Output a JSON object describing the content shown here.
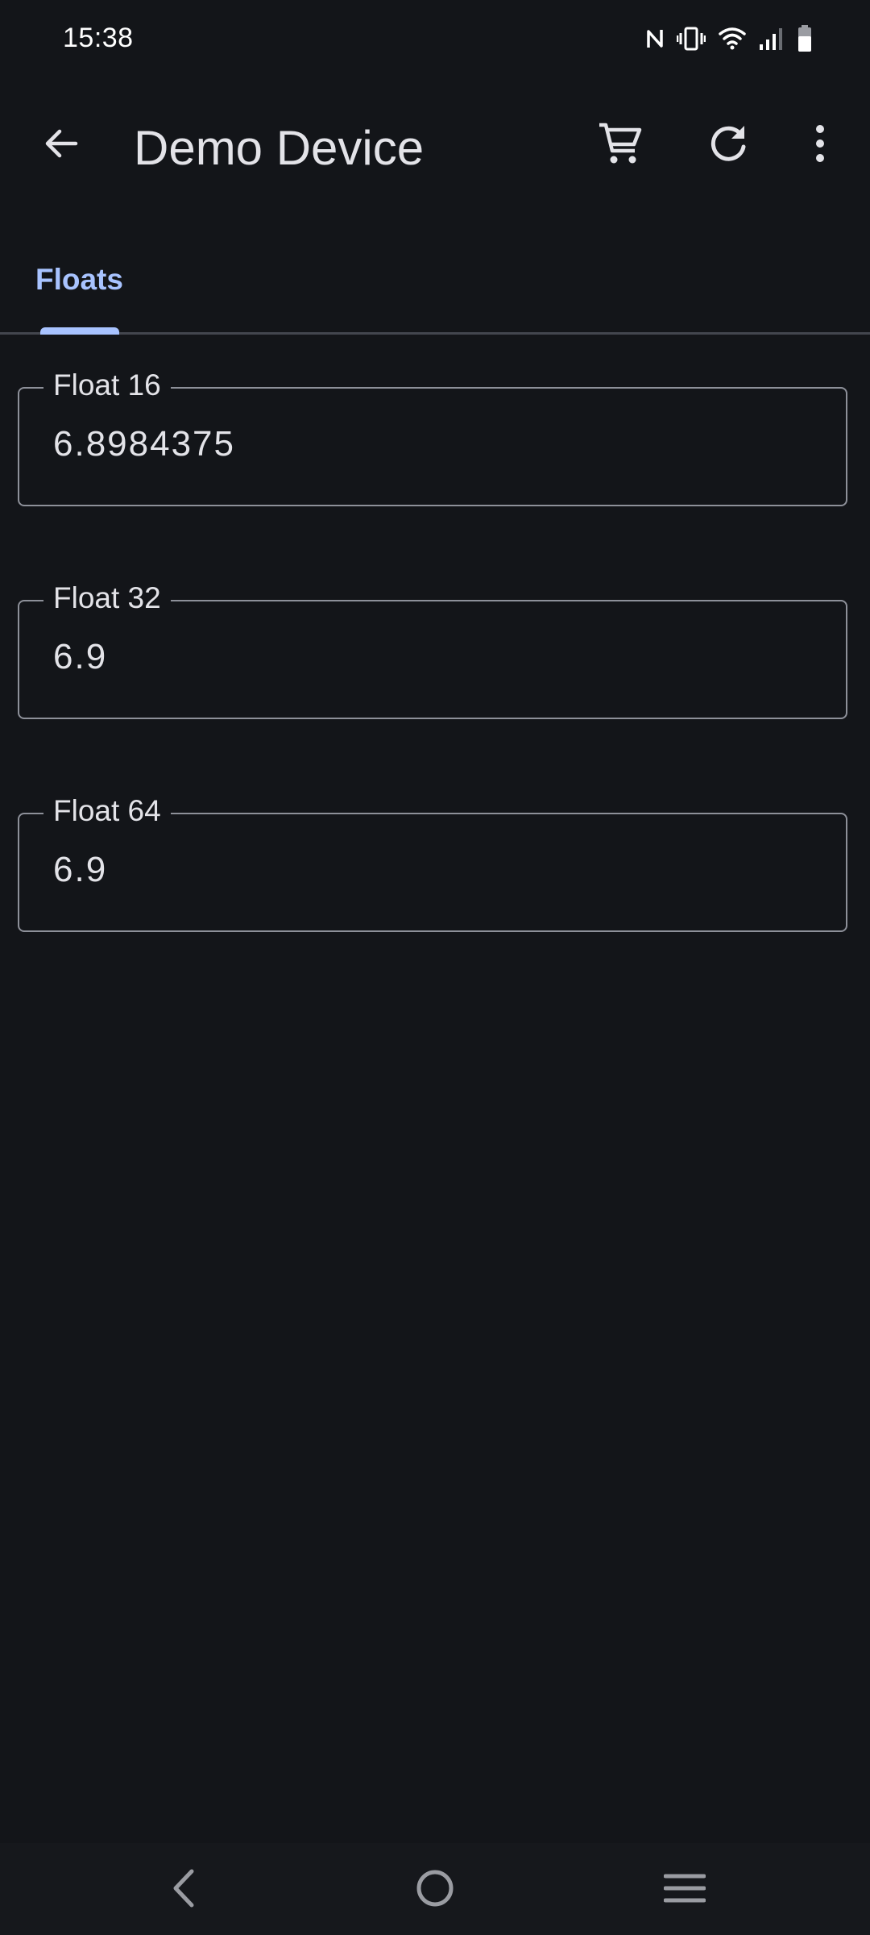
{
  "status_bar": {
    "time": "15:38",
    "icons": [
      "nfc-icon",
      "vibrate-icon",
      "wifi-icon",
      "signal-icon",
      "battery-icon"
    ]
  },
  "app_bar": {
    "title": "Demo Device",
    "actions": [
      "cart-icon",
      "refresh-icon",
      "more-vert-icon"
    ]
  },
  "tabs": [
    {
      "label": "Floats",
      "selected": true
    }
  ],
  "fields": [
    {
      "label": "Float 16",
      "value": "6.8984375"
    },
    {
      "label": "Float 32",
      "value": "6.9"
    },
    {
      "label": "Float 64",
      "value": "6.9"
    }
  ],
  "nav_bar": {
    "buttons": [
      "nav-back-icon",
      "nav-home-icon",
      "nav-recents-icon"
    ]
  },
  "colors": {
    "background": "#131519",
    "accent": "#a8c3ff",
    "text": "#e3e3e8",
    "outline": "#8d9099"
  }
}
